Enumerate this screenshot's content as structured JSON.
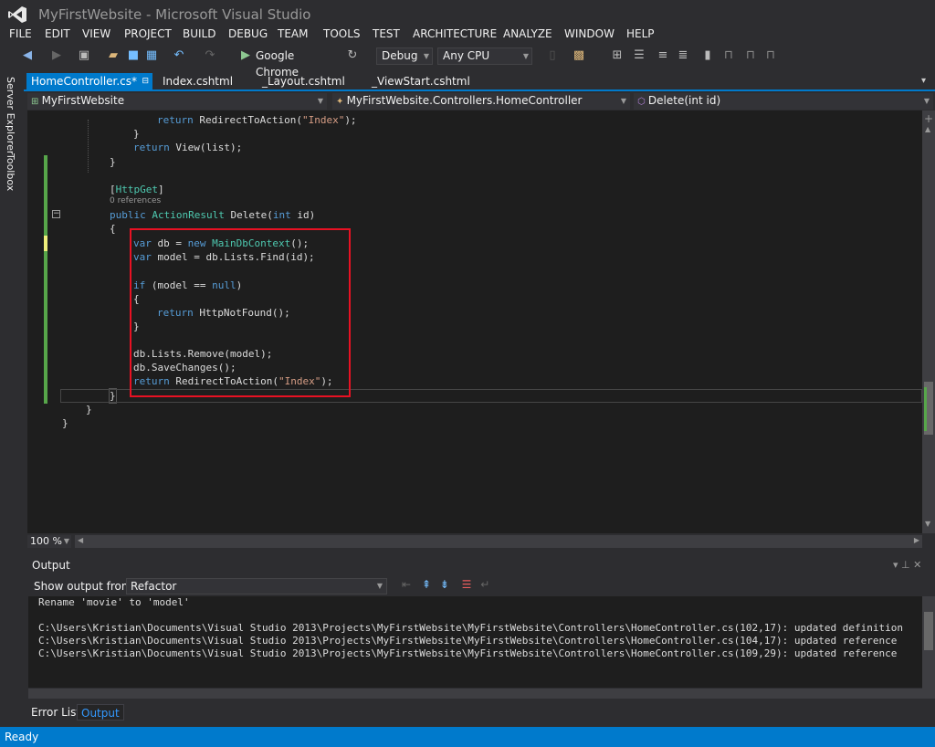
{
  "window": {
    "title": "MyFirstWebsite - Microsoft Visual Studio"
  },
  "menu": [
    "FILE",
    "EDIT",
    "VIEW",
    "PROJECT",
    "BUILD",
    "DEBUG",
    "TEAM",
    "TOOLS",
    "TEST",
    "ARCHITECTURE",
    "ANALYZE",
    "WINDOW",
    "HELP"
  ],
  "toolbar": {
    "run_target": "Google Chrome",
    "configuration": "Debug",
    "platform": "Any CPU"
  },
  "side_tabs": [
    "Server Explorer",
    "Toolbox"
  ],
  "tabs": [
    "HomeController.cs*",
    "Index.cshtml",
    "_Layout.cshtml",
    "_ViewStart.cshtml"
  ],
  "nav": {
    "project": "MyFirstWebsite",
    "class": "MyFirstWebsite.Controllers.HomeController",
    "member": "Delete(int id)"
  },
  "code": {
    "l1": [
      "return ",
      "RedirectToAction(",
      "\"Index\"",
      ");"
    ],
    "l2": "}",
    "l3": [
      "return ",
      "View(list);"
    ],
    "l4": "}",
    "attr_open": "[",
    "attr_name": "HttpGet",
    "attr_close": "]",
    "codelens": "0 references",
    "sig": [
      "public ",
      "ActionResult",
      " Delete(",
      "int",
      " id)"
    ],
    "open_brace": "{",
    "l_var1": [
      "var",
      " db = ",
      "new ",
      "MainDbContext",
      "();"
    ],
    "l_var2": [
      "var",
      " model = db.Lists.Find(id);"
    ],
    "l_if": [
      "if",
      " (model == ",
      "null",
      ")"
    ],
    "l_ob": "{",
    "l_ret_nf": [
      "return ",
      "HttpNotFound();"
    ],
    "l_cb": "}",
    "l_remove": "db.Lists.Remove(model);",
    "l_save": "db.SaveChanges();",
    "l_ret": [
      "return ",
      "RedirectToAction(",
      "\"Index\"",
      ");"
    ],
    "close_method": "}",
    "close_class": "}",
    "close_ns": "}"
  },
  "zoom": "100 %",
  "output": {
    "title": "Output",
    "show_from_label": "Show output from:",
    "source": "Refactor",
    "lines": [
      "Rename 'movie' to 'model'",
      "",
      "C:\\Users\\Kristian\\Documents\\Visual Studio 2013\\Projects\\MyFirstWebsite\\MyFirstWebsite\\Controllers\\HomeController.cs(102,17): updated definition",
      "C:\\Users\\Kristian\\Documents\\Visual Studio 2013\\Projects\\MyFirstWebsite\\MyFirstWebsite\\Controllers\\HomeController.cs(104,17): updated reference",
      "C:\\Users\\Kristian\\Documents\\Visual Studio 2013\\Projects\\MyFirstWebsite\\MyFirstWebsite\\Controllers\\HomeController.cs(109,29): updated reference"
    ]
  },
  "bottom_tabs": [
    "Error List",
    "Output"
  ],
  "status": "Ready",
  "colors": {
    "accent": "#007acc",
    "highlight_box": "#e81123",
    "gutter_saved": "#57a64a",
    "gutter_unsaved": "#efef7b"
  }
}
